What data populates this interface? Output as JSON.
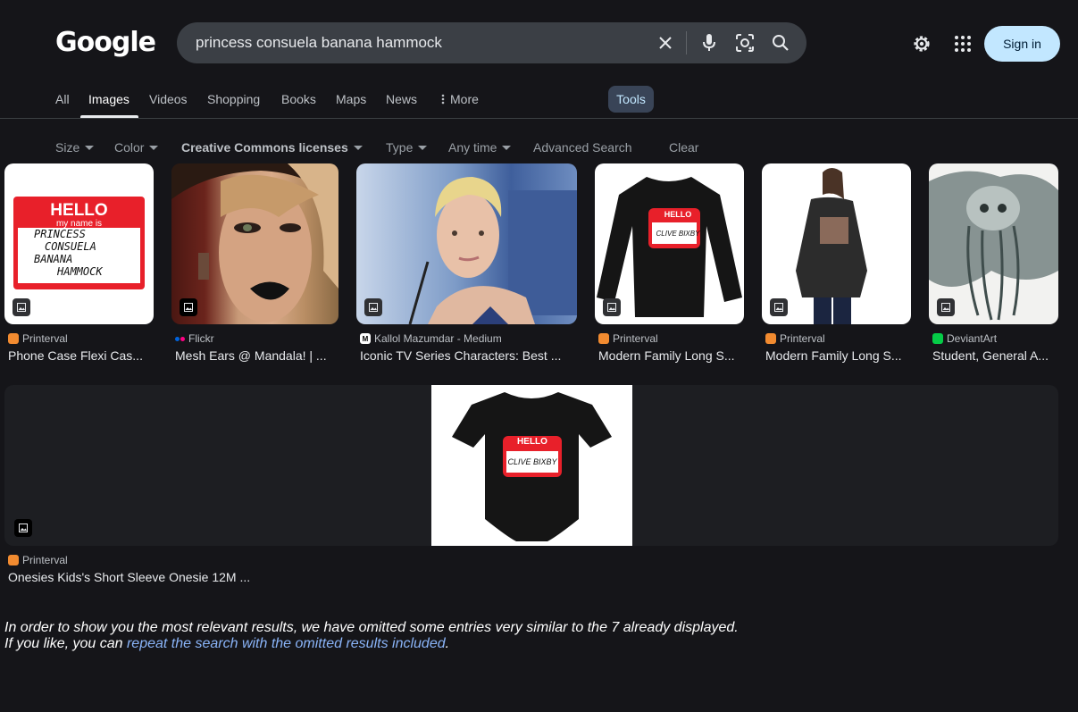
{
  "header": {
    "logo": "Google",
    "search_query": "princess consuela banana hammock",
    "signin_label": "Sign in"
  },
  "tabs": [
    {
      "label": "All",
      "active": false
    },
    {
      "label": "Images",
      "active": true
    },
    {
      "label": "Videos",
      "active": false
    },
    {
      "label": "Shopping",
      "active": false
    },
    {
      "label": "Books",
      "active": false
    },
    {
      "label": "Maps",
      "active": false
    },
    {
      "label": "News",
      "active": false
    },
    {
      "label": "More",
      "active": false
    }
  ],
  "tools_label": "Tools",
  "filters": [
    {
      "label": "Size",
      "dropdown": true
    },
    {
      "label": "Color",
      "dropdown": true
    },
    {
      "label": "Creative Commons licenses",
      "dropdown": true
    },
    {
      "label": "Type",
      "dropdown": true
    },
    {
      "label": "Any time",
      "dropdown": true
    },
    {
      "label": "Advanced Search",
      "dropdown": false
    },
    {
      "label": "Clear",
      "dropdown": false
    }
  ],
  "results": [
    {
      "source": "Printerval",
      "title": "Phone Case Flexi Cas...",
      "image": "hello-name-tag",
      "tag_lines": [
        "HELLO",
        "my name is",
        "PRINCESS",
        "CONSUELA",
        "BANANA",
        "HAMMOCK"
      ]
    },
    {
      "source": "Flickr",
      "title": "Mesh Ears @ Mandala! | ...",
      "image": "avatar-portrait"
    },
    {
      "source": "Kallol Mazumdar - Medium",
      "title": "Iconic TV Series Characters: Best ...",
      "image": "actress-photo"
    },
    {
      "source": "Printerval",
      "title": "Modern Family Long S...",
      "image": "long-sleeve-shirt",
      "tag_lines": [
        "HELLO",
        "my name is",
        "CLIVE BIXBY"
      ]
    },
    {
      "source": "Printerval",
      "title": "Modern Family Long S...",
      "image": "model-shirt"
    },
    {
      "source": "DeviantArt",
      "title": "Student, General A...",
      "image": "jellyfish-art"
    },
    {
      "source": "Printerval",
      "title": "Onesies Kids's Short Sleeve Onesie 12M ...",
      "image": "onesie",
      "tag_lines": [
        "HELLO",
        "my name is",
        "CLIVE BIXBY"
      ]
    }
  ],
  "notice": {
    "line1": "In order to show you the most relevant results, we have omitted some entries very similar to the 7 already displayed.",
    "line2_prefix": "If you like, you can ",
    "link": "repeat the search with the omitted results included",
    "line2_suffix": "."
  },
  "colors": {
    "background": "#151519",
    "signin_bg": "#c2e7ff",
    "tools_bg": "#394457",
    "link": "#8ab4f8"
  }
}
